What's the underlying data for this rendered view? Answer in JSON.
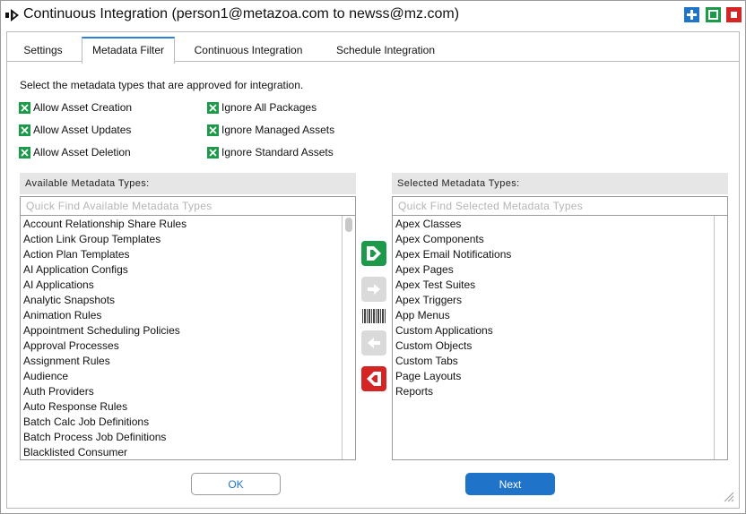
{
  "window": {
    "title": "Continuous Integration (person1@metazoa.com to newss@mz.com)",
    "controls": [
      "add-icon",
      "maximize-icon",
      "close-icon"
    ]
  },
  "tabs": [
    {
      "label": "Settings",
      "active": false
    },
    {
      "label": "Metadata Filter",
      "active": true
    },
    {
      "label": "Continuous Integration",
      "active": false
    },
    {
      "label": "Schedule Integration",
      "active": false
    }
  ],
  "instructions": "Select the metadata types that are approved for integration.",
  "options": [
    {
      "label": "Allow Asset Creation",
      "checked": true
    },
    {
      "label": "Allow Asset Updates",
      "checked": true
    },
    {
      "label": "Allow Asset Deletion",
      "checked": true
    },
    {
      "label": "Ignore All Packages",
      "checked": true
    },
    {
      "label": "Ignore Managed Assets",
      "checked": true
    },
    {
      "label": "Ignore Standard Assets",
      "checked": true
    }
  ],
  "available": {
    "header": "Available Metadata Types:",
    "placeholder": "Quick Find Available Metadata Types",
    "items": [
      "Account Relationship Share Rules",
      "Action Link Group Templates",
      "Action Plan Templates",
      "AI Application Configs",
      "AI Applications",
      "Analytic Snapshots",
      "Animation Rules",
      "Appointment Scheduling Policies",
      "Approval Processes",
      "Assignment Rules",
      "Audience",
      "Auth Providers",
      "Auto Response Rules",
      "Batch Calc Job Definitions",
      "Batch Process Job Definitions",
      "Blacklisted Consumer"
    ]
  },
  "selected": {
    "header": "Selected Metadata Types:",
    "placeholder": "Quick Find Selected Metadata Types",
    "items": [
      "Apex Classes",
      "Apex Components",
      "Apex Email Notifications",
      "Apex Pages",
      "Apex Test Suites",
      "Apex Triggers",
      "App Menus",
      "Custom Applications",
      "Custom Objects",
      "Custom Tabs",
      "Page Layouts",
      "Reports"
    ]
  },
  "buttons": {
    "ok": "OK",
    "next": "Next"
  },
  "colors": {
    "accent": "#1f73c8",
    "green": "#1c9a4a",
    "red": "#d42424"
  }
}
